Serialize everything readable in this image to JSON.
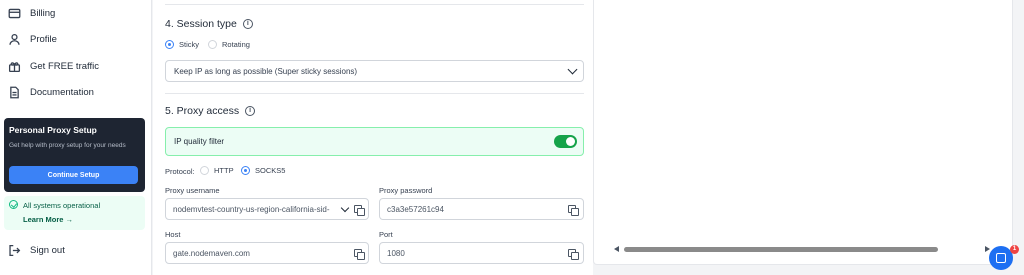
{
  "sidebar": {
    "items": [
      {
        "label": "Billing",
        "icon": "card-icon"
      },
      {
        "label": "Profile",
        "icon": "user-icon"
      },
      {
        "label": "Get FREE traffic",
        "icon": "gift-icon"
      },
      {
        "label": "Documentation",
        "icon": "document-icon"
      }
    ],
    "promo": {
      "title": "Personal Proxy Setup",
      "description": "Get help with proxy setup for your needs",
      "button": "Continue Setup"
    },
    "status": {
      "text": "All systems operational",
      "link": "Learn More"
    },
    "sign_out": "Sign out"
  },
  "session": {
    "title": "4. Session type",
    "options": [
      "Sticky",
      "Rotating"
    ],
    "selected": "Sticky",
    "select_value": "Keep IP as long as possible (Super sticky sessions)"
  },
  "proxy": {
    "title": "5. Proxy access",
    "quality_filter_label": "IP quality filter",
    "quality_filter_on": true,
    "protocol_label": "Protocol:",
    "protocols": [
      "HTTP",
      "SOCKS5"
    ],
    "protocol_selected": "SOCKS5",
    "username_label": "Proxy username",
    "username_value": "nodemvtest-country-us-region-california-sid-",
    "password_label": "Proxy password",
    "password_value": "c3a3e57261c94",
    "host_label": "Host",
    "host_value": "gate.nodemaven.com",
    "port_label": "Port",
    "port_value": "1080"
  },
  "chat": {
    "badge": "1"
  },
  "colors": {
    "accent": "#3b82f6",
    "success": "#16a34a",
    "dark": "#1e2532"
  }
}
